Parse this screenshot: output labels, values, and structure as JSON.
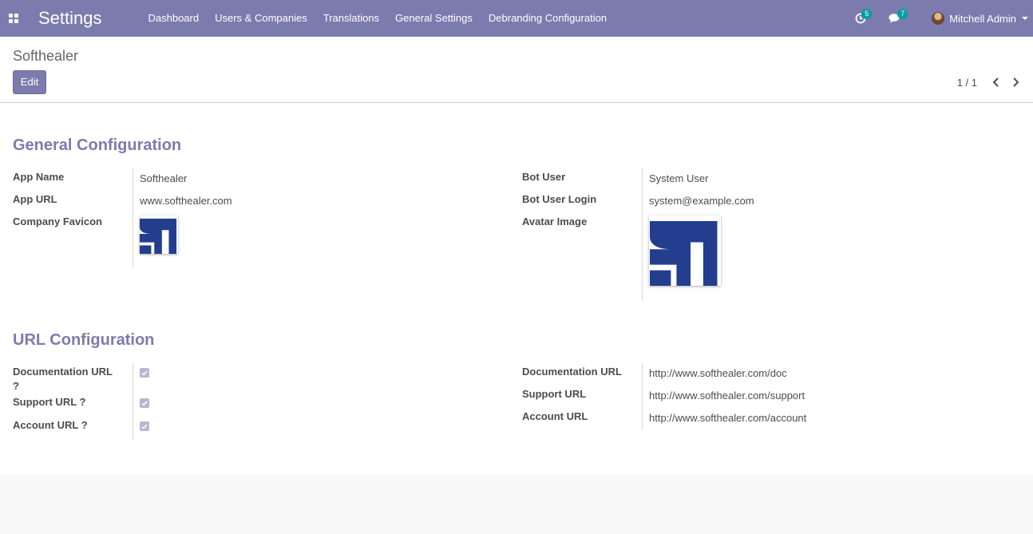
{
  "navbar": {
    "app_title": "Settings",
    "menu": [
      "Dashboard",
      "Users & Companies",
      "Translations",
      "General Settings",
      "Debranding Configuration"
    ],
    "activity_count": "5",
    "message_count": "7",
    "user_name": "Mitchell Admin",
    "colors": {
      "bg": "#7c7bad",
      "badge": "#00a09d"
    }
  },
  "control_panel": {
    "breadcrumb": "Softhealer",
    "edit_label": "Edit",
    "pager_value": "1 / 1"
  },
  "general": {
    "title": "General Configuration",
    "app_name_label": "App Name",
    "app_name_value": "Softhealer",
    "app_url_label": "App URL",
    "app_url_value": "www.softhealer.com",
    "favicon_label": "Company Favicon",
    "bot_user_label": "Bot User",
    "bot_user_value": "System User",
    "bot_login_label": "Bot User Login",
    "bot_login_value": "system@example.com",
    "avatar_label": "Avatar Image"
  },
  "url": {
    "title": "URL Configuration",
    "doc_check_label_1": "Documentation URL",
    "doc_check_label_2": "?",
    "support_check_label": "Support URL ?",
    "account_check_label": "Account URL ?",
    "doc_url_label": "Documentation URL",
    "doc_url_value": "http://www.softhealer.com/doc",
    "support_url_label": "Support URL",
    "support_url_value": "http://www.softhealer.com/support",
    "account_url_label": "Account URL",
    "account_url_value": "http://www.softhealer.com/account"
  },
  "logo": {
    "text": "SH",
    "color": "#233d8f"
  }
}
